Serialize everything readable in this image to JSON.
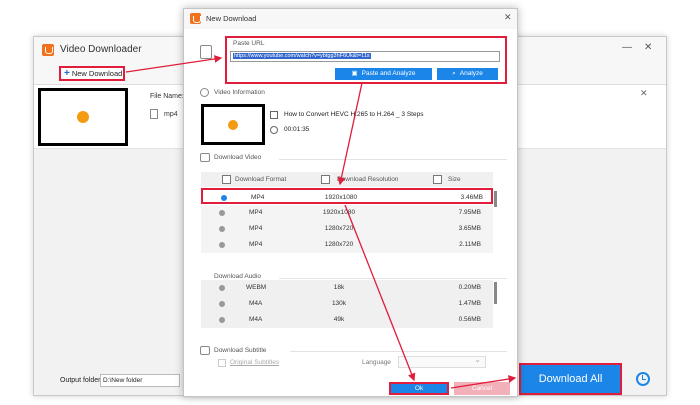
{
  "main_window": {
    "title": "Video Downloader",
    "minimize_glyph": "—",
    "close_glyph": "✕",
    "new_download_label": "New Download",
    "plus_glyph": "+",
    "task": {
      "file_name_label": "File Name:",
      "format": "mp4",
      "close_glyph": "✕"
    },
    "output_folder_label": "Output folder:",
    "output_folder_value": "D:\\New folder",
    "download_all_label": "Download All"
  },
  "dialog": {
    "title": "New Download",
    "close_glyph": "✕",
    "paste_url": {
      "label": "Paste URL",
      "url": "https://www.youtube.com/watch?v=ybtgg3hF6Uk&t=11s",
      "paste_analyze_label": "Paste and Analyze",
      "analyze_label": "Analyze"
    },
    "video_information": {
      "label": "Video Information",
      "title": "How to Convert HEVC H.265 to H.264 _ 3 Steps",
      "duration": "00:01:35"
    },
    "download_video": {
      "label": "Download Video",
      "columns": [
        "Download Format",
        "Download Resolution",
        "Size"
      ],
      "rows": [
        {
          "format": "MP4",
          "resolution": "1920x1080",
          "size": "3.46MB",
          "selected": true
        },
        {
          "format": "MP4",
          "resolution": "1920x1080",
          "size": "7.95MB",
          "selected": false
        },
        {
          "format": "MP4",
          "resolution": "1280x720",
          "size": "3.65MB",
          "selected": false
        },
        {
          "format": "MP4",
          "resolution": "1280x720",
          "size": "2.11MB",
          "selected": false
        }
      ]
    },
    "download_audio": {
      "label": "Download Audio",
      "rows": [
        {
          "format": "WEBM",
          "bitrate": "18k",
          "size": "0.20MB"
        },
        {
          "format": "M4A",
          "bitrate": "130k",
          "size": "1.47MB"
        },
        {
          "format": "M4A",
          "bitrate": "49k",
          "size": "0.56MB"
        }
      ]
    },
    "download_subtitle": {
      "label": "Download Subtitle",
      "original_subtitles_label": "Original Subtitles",
      "language_label": "Language"
    },
    "ok_label": "Ok",
    "cancel_label": "Cancel"
  },
  "colors": {
    "accent_blue": "#1c86e8",
    "highlight_red": "#e01d3a",
    "logo_orange": "#f2711c"
  }
}
